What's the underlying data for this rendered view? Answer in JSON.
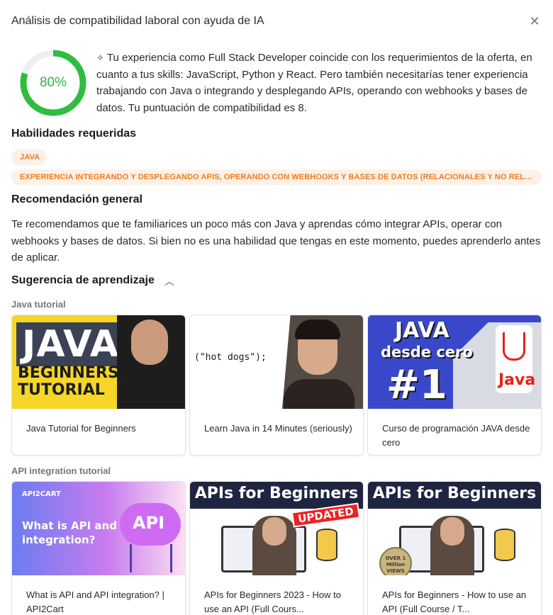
{
  "dialog": {
    "title": "Análisis de compatibilidad laboral con ayuda de IA",
    "close_icon": "close-icon"
  },
  "score": {
    "value": 80,
    "label": "80%",
    "ring_color": "#2ebd3f",
    "track_color": "#eeeeee"
  },
  "summary": {
    "icon": "sparkle-icon",
    "sparkle_glyph": "✧",
    "text": "Tu experiencia como Full Stack Developer coincide con los requerimientos de la oferta, en cuanto a tus skills: JavaScript, Python y React. Pero también necesitarías tener experiencia trabajando con Java o integrando y desplegando APIs, operando con webhooks y bases de datos. Tu puntuación de compatibilidad es 8."
  },
  "skills": {
    "title": "Habilidades requeridas",
    "chips": [
      "JAVA",
      "EXPERIENCIA INTEGRANDO Y DESPLEGANDO APIS, OPERANDO CON WEBHOOKS Y BASES DE DATOS (RELACIONALES Y NO RELACI..."
    ],
    "chip_color": "#f07b1e",
    "chip_bg": "#fdf1e7"
  },
  "recommendation": {
    "title": "Recomendación general",
    "text": "Te recomendamos que te familiarices un poco más con Java y aprendas cómo integrar APIs, operar con webhooks y bases de datos. Si bien no es una habilidad que tengas en este momento, puedes aprenderlo antes de aplicar."
  },
  "learning": {
    "title": "Sugerencia de aprendizaje",
    "toggle_icon": "chevron-up-icon",
    "groups": [
      {
        "label": "Java tutorial",
        "videos": [
          {
            "title": "Java Tutorial for Beginners",
            "thumb_text": [
              "JAVA",
              "BEGINNERS",
              "TUTORIAL"
            ]
          },
          {
            "title": "Learn Java in 14 Minutes (seriously)",
            "thumb_text": [
              "(\"hot dogs\");"
            ]
          },
          {
            "title": "Curso de programación JAVA desde cero",
            "thumb_text": [
              "JAVA",
              "desde cero",
              "#1",
              "Java"
            ]
          }
        ]
      },
      {
        "label": "API integration tutorial",
        "videos": [
          {
            "title": "What is API and API integration? | API2Cart",
            "thumb_text": [
              "API2CART",
              "What is API and API integration?",
              "API"
            ]
          },
          {
            "title": "APIs for Beginners 2023 - How to use an API (Full Cours...",
            "thumb_text": [
              "APIs for Beginners",
              "UPDATED"
            ]
          },
          {
            "title": "APIs for Beginners - How to use an API (Full Course / T...",
            "thumb_text": [
              "APIs for Beginners",
              "OVER 1 Million VIEWS"
            ]
          }
        ]
      }
    ]
  }
}
